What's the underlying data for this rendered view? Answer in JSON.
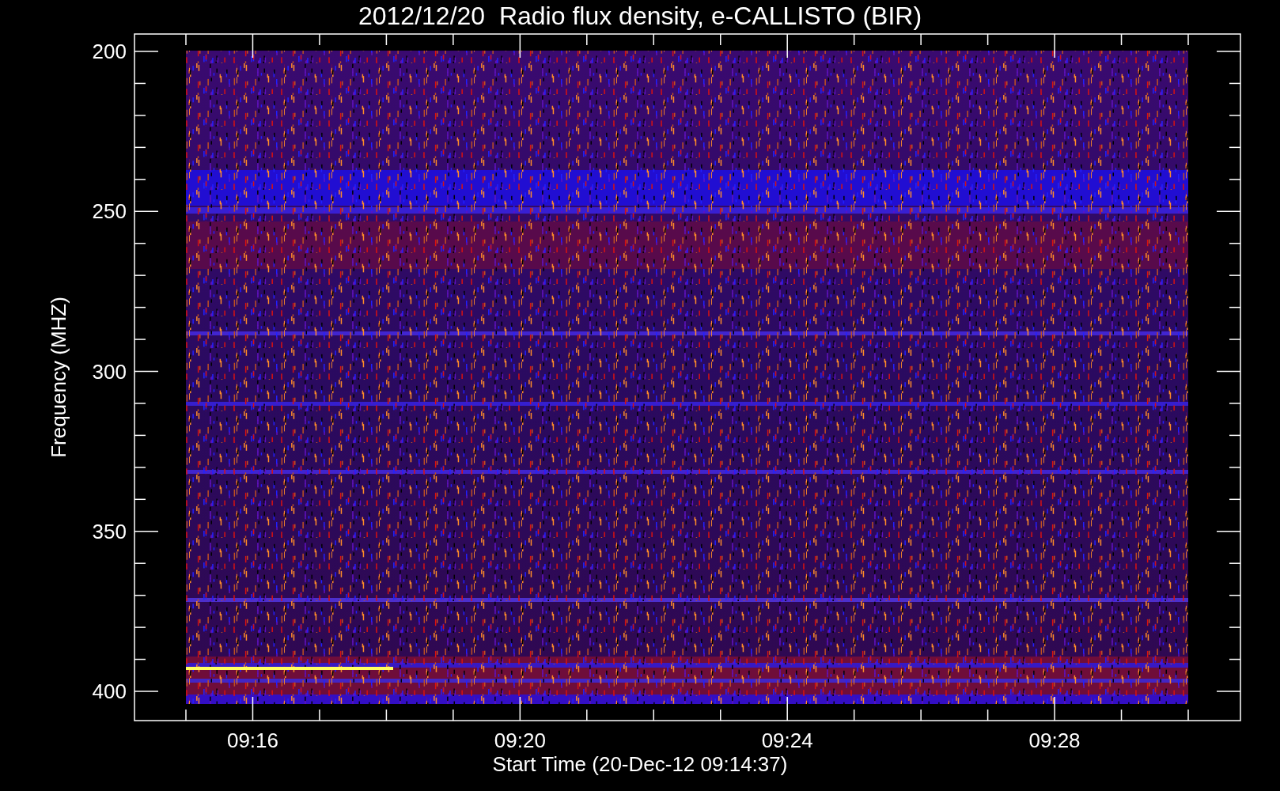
{
  "title": "2012/12/20  Radio flux density, e-CALLISTO (BIR)",
  "y_axis": {
    "label": "Frequency (MHZ)",
    "ticks": [
      "200",
      "250",
      "300",
      "350",
      "400"
    ]
  },
  "x_axis": {
    "label": "Start Time (20-Dec-12 09:14:37)",
    "ticks": [
      "09:16",
      "09:20",
      "09:24",
      "09:28"
    ]
  }
}
